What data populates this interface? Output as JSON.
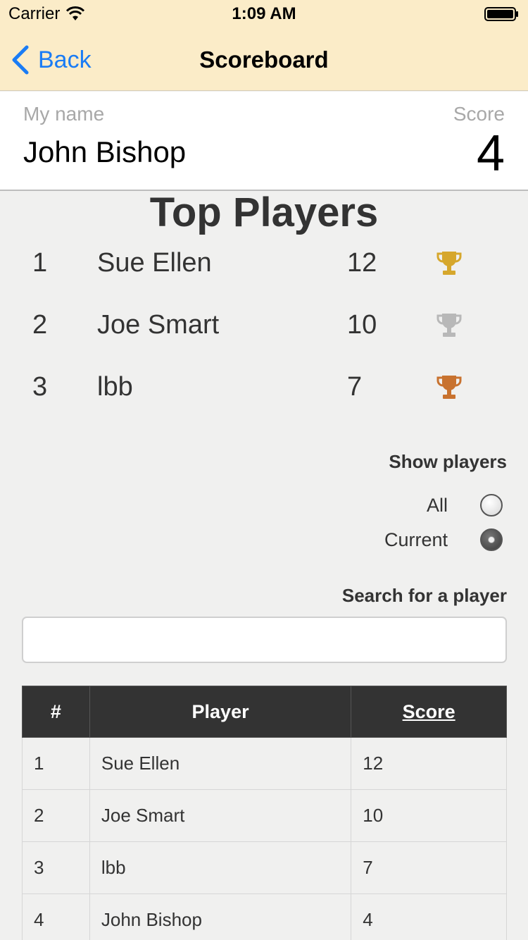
{
  "status_bar": {
    "carrier": "Carrier",
    "time": "1:09 AM"
  },
  "nav": {
    "back_label": "Back",
    "title": "Scoreboard"
  },
  "me": {
    "name_label": "My name",
    "name": "John Bishop",
    "score_label": "Score",
    "score": "4"
  },
  "top_players": {
    "title": "Top Players",
    "rows": [
      {
        "rank": "1",
        "name": "Sue Ellen",
        "score": "12",
        "trophy": "gold-trophy-icon",
        "color": "#d6a72c"
      },
      {
        "rank": "2",
        "name": "Joe Smart",
        "score": "10",
        "trophy": "silver-trophy-icon",
        "color": "#b8b8b8"
      },
      {
        "rank": "3",
        "name": "lbb",
        "score": "7",
        "trophy": "bronze-trophy-icon",
        "color": "#c8722f"
      }
    ]
  },
  "show_players": {
    "label": "Show players",
    "options": [
      {
        "label": "All",
        "checked": false
      },
      {
        "label": "Current",
        "checked": true
      }
    ]
  },
  "search": {
    "label": "Search for a player",
    "value": "",
    "placeholder": ""
  },
  "table": {
    "headers": {
      "rank": "#",
      "player": "Player",
      "score": "Score"
    },
    "rows": [
      {
        "rank": "1",
        "player": "Sue Ellen",
        "score": "12"
      },
      {
        "rank": "2",
        "player": "Joe Smart",
        "score": "10"
      },
      {
        "rank": "3",
        "player": "lbb",
        "score": "7"
      },
      {
        "rank": "4",
        "player": "John Bishop",
        "score": "4"
      }
    ]
  },
  "colors": {
    "nav_bg": "#fbecc8",
    "accent": "#1a7cf5",
    "header_dark": "#333333"
  }
}
